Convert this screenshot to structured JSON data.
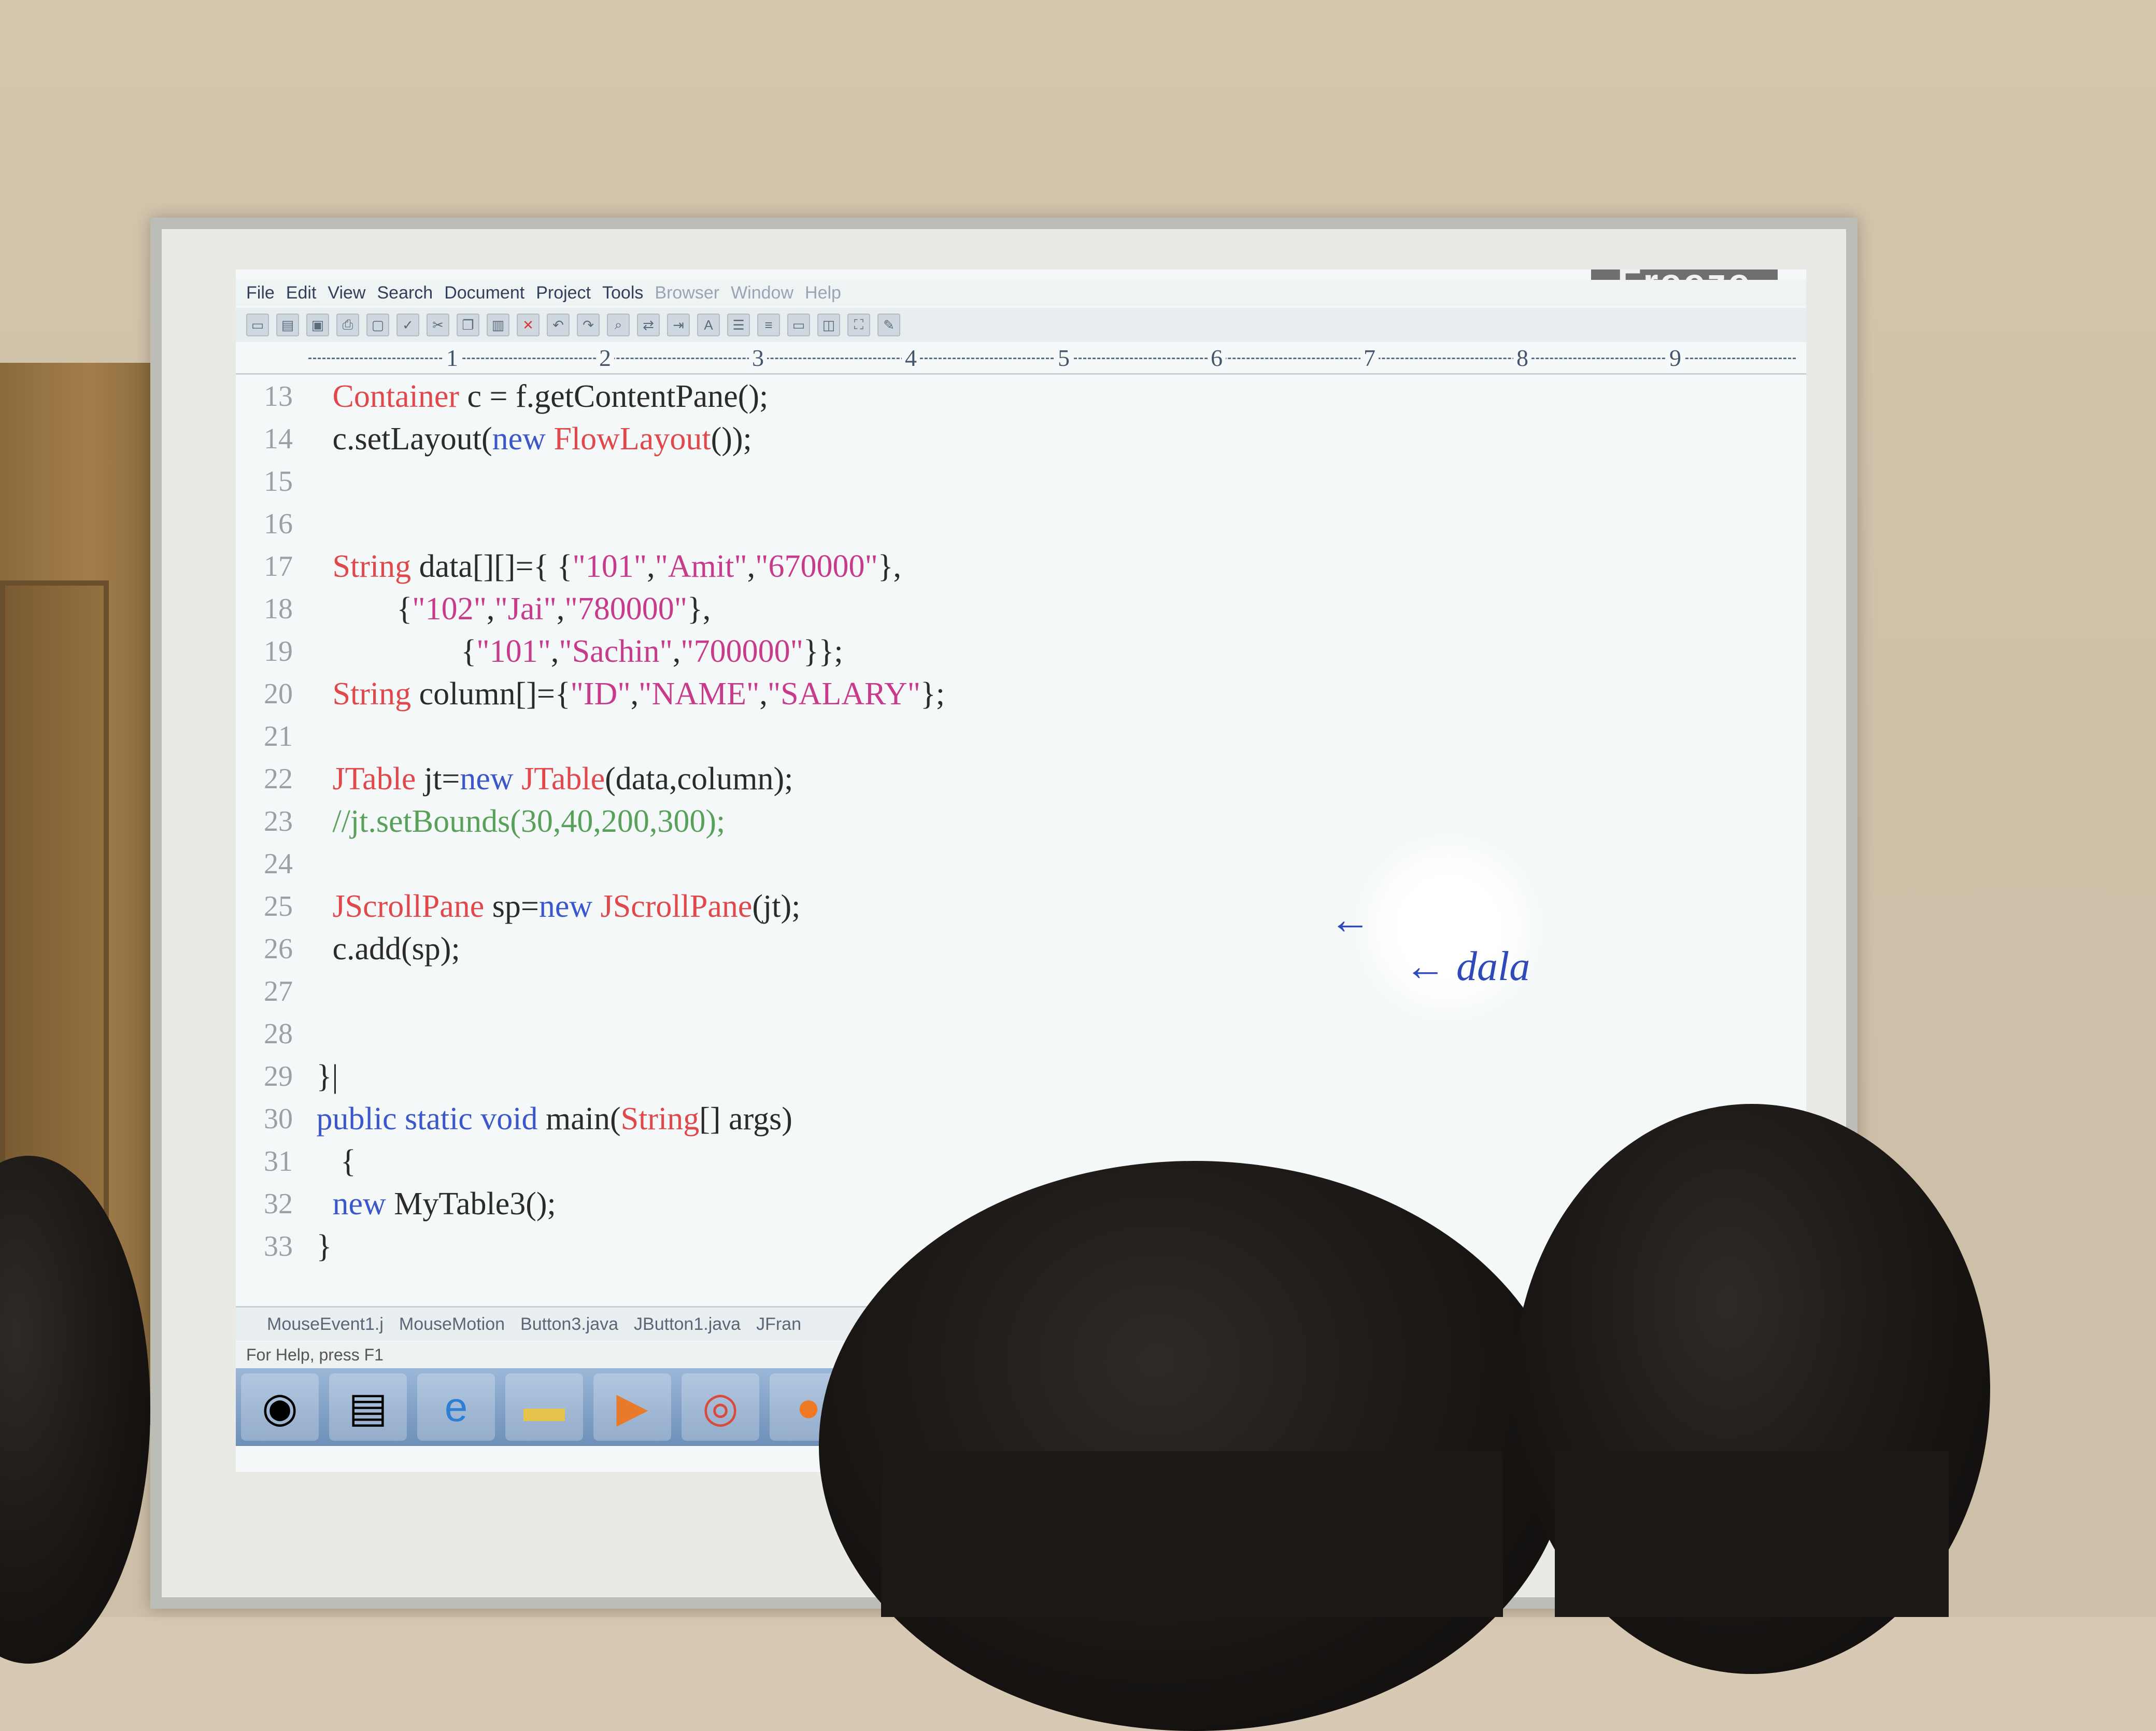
{
  "window": {
    "overlay_label": "Freeze"
  },
  "menu": [
    {
      "label": "File",
      "dim": false
    },
    {
      "label": "Edit",
      "dim": false
    },
    {
      "label": "View",
      "dim": false
    },
    {
      "label": "Search",
      "dim": false
    },
    {
      "label": "Document",
      "dim": false
    },
    {
      "label": "Project",
      "dim": false
    },
    {
      "label": "Tools",
      "dim": false
    },
    {
      "label": "Browser",
      "dim": true
    },
    {
      "label": "Window",
      "dim": true
    },
    {
      "label": "Help",
      "dim": true
    }
  ],
  "ruler": [
    "1",
    "2",
    "3",
    "4",
    "5",
    "6",
    "7",
    "8",
    "9"
  ],
  "code_lines": [
    {
      "n": "13",
      "indent": "   ",
      "parts": [
        {
          "t": "Container",
          "c": "kw-red"
        },
        {
          "t": " c = f.getContentPane();",
          "c": ""
        }
      ]
    },
    {
      "n": "14",
      "indent": "   ",
      "parts": [
        {
          "t": "c.setLayout(",
          "c": ""
        },
        {
          "t": "new",
          "c": "kw-blue"
        },
        {
          "t": " ",
          "c": ""
        },
        {
          "t": "FlowLayout",
          "c": "kw-red"
        },
        {
          "t": "());",
          "c": ""
        }
      ]
    },
    {
      "n": "15",
      "indent": "",
      "parts": []
    },
    {
      "n": "16",
      "indent": "",
      "parts": []
    },
    {
      "n": "17",
      "indent": "   ",
      "parts": [
        {
          "t": "String",
          "c": "kw-red"
        },
        {
          "t": " data[][]={ {",
          "c": ""
        },
        {
          "t": "\"101\"",
          "c": "str"
        },
        {
          "t": ",",
          "c": ""
        },
        {
          "t": "\"Amit\"",
          "c": "str"
        },
        {
          "t": ",",
          "c": ""
        },
        {
          "t": "\"670000\"",
          "c": "str"
        },
        {
          "t": "},",
          "c": ""
        }
      ]
    },
    {
      "n": "18",
      "indent": "           ",
      "parts": [
        {
          "t": "{",
          "c": ""
        },
        {
          "t": "\"102\"",
          "c": "str"
        },
        {
          "t": ",",
          "c": ""
        },
        {
          "t": "\"Jai\"",
          "c": "str"
        },
        {
          "t": ",",
          "c": ""
        },
        {
          "t": "\"780000\"",
          "c": "str"
        },
        {
          "t": "},",
          "c": ""
        }
      ]
    },
    {
      "n": "19",
      "indent": "                   ",
      "parts": [
        {
          "t": "{",
          "c": ""
        },
        {
          "t": "\"101\"",
          "c": "str"
        },
        {
          "t": ",",
          "c": ""
        },
        {
          "t": "\"Sachin\"",
          "c": "str"
        },
        {
          "t": ",",
          "c": ""
        },
        {
          "t": "\"700000\"",
          "c": "str"
        },
        {
          "t": "}};",
          "c": ""
        }
      ]
    },
    {
      "n": "20",
      "indent": "   ",
      "parts": [
        {
          "t": "String",
          "c": "kw-red"
        },
        {
          "t": " column[]={",
          "c": ""
        },
        {
          "t": "\"ID\"",
          "c": "str"
        },
        {
          "t": ",",
          "c": ""
        },
        {
          "t": "\"NAME\"",
          "c": "str"
        },
        {
          "t": ",",
          "c": ""
        },
        {
          "t": "\"SALARY\"",
          "c": "str"
        },
        {
          "t": "};",
          "c": ""
        }
      ]
    },
    {
      "n": "21",
      "indent": "",
      "parts": []
    },
    {
      "n": "22",
      "indent": "   ",
      "parts": [
        {
          "t": "JTable",
          "c": "kw-red"
        },
        {
          "t": " jt=",
          "c": ""
        },
        {
          "t": "new",
          "c": "kw-blue"
        },
        {
          "t": " ",
          "c": ""
        },
        {
          "t": "JTable",
          "c": "kw-red"
        },
        {
          "t": "(data,column);",
          "c": ""
        }
      ]
    },
    {
      "n": "23",
      "indent": "   ",
      "parts": [
        {
          "t": "//jt.setBounds(30,40,200,300);",
          "c": "cmt"
        }
      ]
    },
    {
      "n": "24",
      "indent": "",
      "parts": []
    },
    {
      "n": "25",
      "indent": "   ",
      "parts": [
        {
          "t": "JScrollPane",
          "c": "kw-red"
        },
        {
          "t": " sp=",
          "c": ""
        },
        {
          "t": "new",
          "c": "kw-blue"
        },
        {
          "t": " ",
          "c": ""
        },
        {
          "t": "JScrollPane",
          "c": "kw-red"
        },
        {
          "t": "(jt);",
          "c": ""
        }
      ]
    },
    {
      "n": "26",
      "indent": "   ",
      "parts": [
        {
          "t": "c.add(sp);",
          "c": ""
        }
      ]
    },
    {
      "n": "27",
      "indent": "",
      "parts": []
    },
    {
      "n": "28",
      "indent": "",
      "parts": []
    },
    {
      "n": "29",
      "indent": " ",
      "parts": [
        {
          "t": "}|",
          "c": ""
        }
      ]
    },
    {
      "n": "30",
      "indent": " ",
      "parts": [
        {
          "t": "public static void",
          "c": "kw-blue"
        },
        {
          "t": " main(",
          "c": ""
        },
        {
          "t": "String",
          "c": "kw-red"
        },
        {
          "t": "[] args)",
          "c": ""
        }
      ]
    },
    {
      "n": "31",
      "indent": "    ",
      "parts": [
        {
          "t": "{",
          "c": ""
        }
      ]
    },
    {
      "n": "32",
      "indent": "   ",
      "parts": [
        {
          "t": "new",
          "c": "kw-blue"
        },
        {
          "t": " MyTable3();",
          "c": ""
        }
      ]
    },
    {
      "n": "33",
      "indent": " ",
      "parts": [
        {
          "t": "}",
          "c": ""
        }
      ]
    }
  ],
  "file_tabs": [
    "MouseEvent1.j",
    "MouseMotion",
    "Button3.java",
    "JButton1.java",
    "JFran"
  ],
  "status_text": "For Help, press F1",
  "annotation": "← dala",
  "colors": {
    "keyword_red": "#e0484c",
    "keyword_blue": "#3b57c9",
    "string": "#c83a8a",
    "comment": "#59a15a"
  }
}
